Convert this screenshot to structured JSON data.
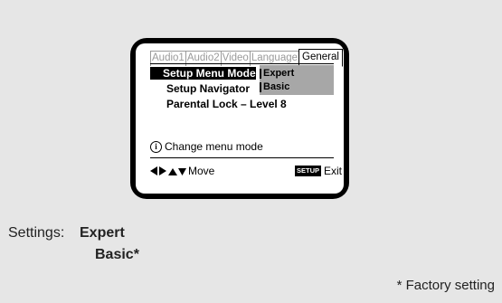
{
  "tabs": [
    "Audio1",
    "Audio2",
    "Video",
    "Language",
    "General"
  ],
  "active_tab": "General",
  "menu": {
    "setup_menu_mode": "Setup Menu Mode",
    "setup_navigator": "Setup Navigator",
    "parental_lock": "Parental Lock – Level 8"
  },
  "options": [
    "Expert",
    "Basic"
  ],
  "info": {
    "icon": "info-icon",
    "text": "Change menu mode"
  },
  "footer": {
    "move_label": "Move",
    "setup_key": "SETUP",
    "exit_label": "Exit"
  },
  "caption": {
    "settings_label": "Settings:",
    "expert": "Expert",
    "basic": "Basic*",
    "factory_note": "* Factory setting"
  },
  "colors": {
    "page_background": "#e6e6e6",
    "tv_frame": "#000000",
    "highlight_row": "#000000",
    "option_panel": "#a7a7a7",
    "inactive_tab": "#9a9a9a"
  }
}
